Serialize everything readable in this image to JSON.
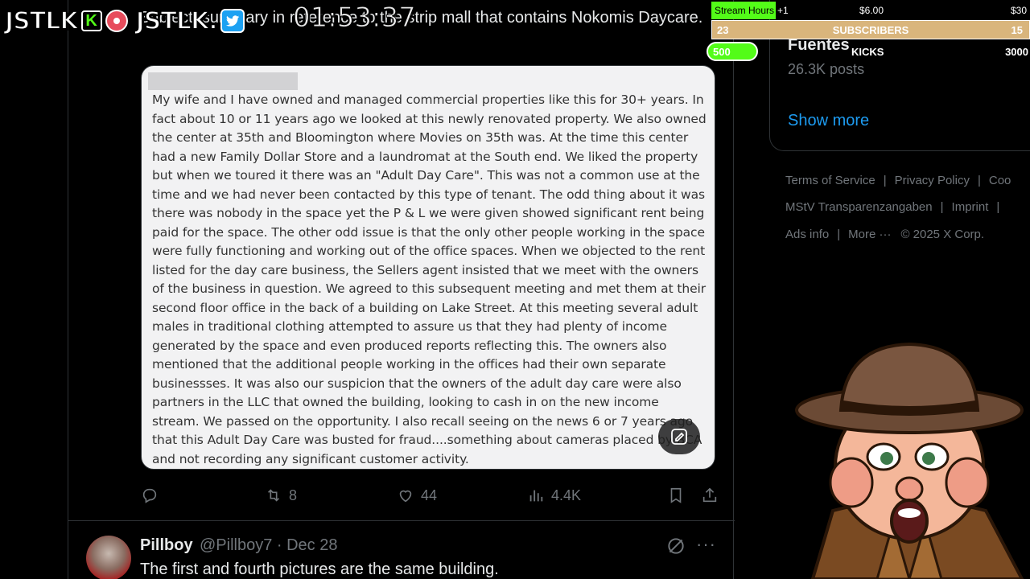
{
  "post": {
    "text": "Subject: summary in reference to the strip mall that contains Nokomis Daycare.",
    "image_text": "My wife and I have owned and managed commercial properties like this for 30+ years. In fact about 10 or 11 years ago we looked at this newly renovated property. We also owned the center at 35th and Bloomington where Movies on 35th was. At the time this center had a new Family Dollar Store and a laundromat at the South end. We liked the property but when we toured it there was an \"Adult Day Care\". This was not a common use at the time and we had never been contacted by this type of tenant. The odd thing about it was there was nobody in the space yet the P & L we were given showed significant rent being paid for the space. The other odd issue is that the only other people working in the space were fully functioning and working out of the office spaces. When we objected to the rent listed for the day care business, the Sellers agent insisted that we meet with the owners of the business in question. We agreed to this subsequent meeting and met them at their second floor office in the back of a building on Lake Street. At this meeting several adult males in traditional clothing attempted to assure us that they had plenty of income generated by the space and even produced reports reflecting this. The owners also mentioned that the additional people working in the offices had their own separate businessses. It was also our suspicion that the owners of the adult day care were also partners in the LLC that owned the building, looking to cash in on the new income stream. We passed on the opportunity. I also recall seeing on the news 6 or 7 years ago that this Adult Day Care was busted for fraud....something about cameras placed by BCA and not recording any significant customer activity.",
    "actions": {
      "reposts": "8",
      "likes": "44",
      "views": "4.4K"
    }
  },
  "reply": {
    "name": "Pillboy",
    "meta": "@Pillboy7 · Dec 28",
    "text": "The first and fourth pictures are the same building."
  },
  "sidebar": {
    "profile_name": "Fuentes",
    "posts_count": "26.3K posts",
    "show_more": "Show more",
    "footer": {
      "terms": "Terms of Service",
      "privacy": "Privacy Policy",
      "cookies": "Coo",
      "mstv": "MStV Transparenzangaben",
      "imprint": "Imprint",
      "ads": "Ads info",
      "more": "More ···",
      "copyright": "© 2025 X Corp."
    }
  },
  "overlay": {
    "logo_left": "JSTLK",
    "kick_letter": "K",
    "logo_right": "JSTLK.",
    "timer": "01:53:37",
    "goals": {
      "stream_hours_label": "Stream Hours",
      "stream_hours_inc": "+1",
      "stream_hours_amount": "$6.00",
      "stream_hours_max": "$30",
      "subs_current": "23",
      "subs_label": "SUBSCRIBERS",
      "subs_goal": "15",
      "kicks_current": "500",
      "kicks_label": "KICKS",
      "kicks_goal": "3000"
    }
  },
  "colors": {
    "accent_blue": "#1d9bf0",
    "kick_green": "#53fc18",
    "muted": "#71767b"
  }
}
